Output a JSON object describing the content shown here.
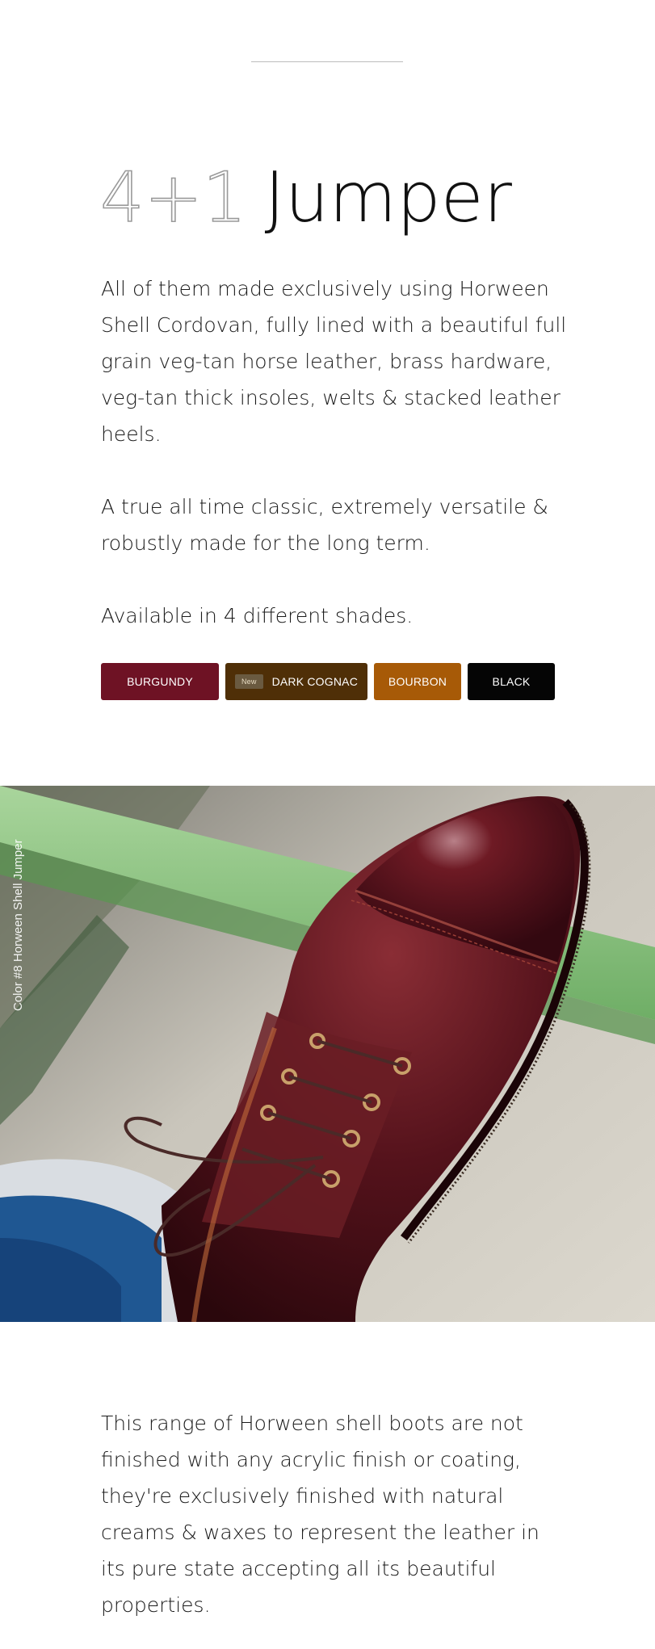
{
  "title": {
    "number": "4+1",
    "word": "Jumper"
  },
  "paragraphs": {
    "intro": "All of them made exclusively using Horween Shell Cordovan, fully lined with a beautiful full grain veg-tan horse leather, brass hardware, veg-tan thick insoles, welts & stacked leather heels.",
    "classic": "A true all time classic, extremely versatile & robustly made for the long term.",
    "availability": "Available in 4 different shades.",
    "finish": "This range of Horween shell boots are not finished with any acrylic finish or coating, they're exclusively finished with natural creams & waxes to represent the leather in its pure state accepting all its beautiful properties."
  },
  "shades": [
    {
      "label": "BURGUNDY",
      "color": "#6e1224",
      "badge": ""
    },
    {
      "label": "DARK COGNAC",
      "color": "#4f2f07",
      "badge": "New"
    },
    {
      "label": "BOURBON",
      "color": "#a75a07",
      "badge": ""
    },
    {
      "label": "BLACK",
      "color": "#050505",
      "badge": ""
    }
  ],
  "photo": {
    "caption": "Color #8 Horween Shell Jumper",
    "subject": "burgundy shell cordovan lace-up boot resting on a green rail"
  }
}
